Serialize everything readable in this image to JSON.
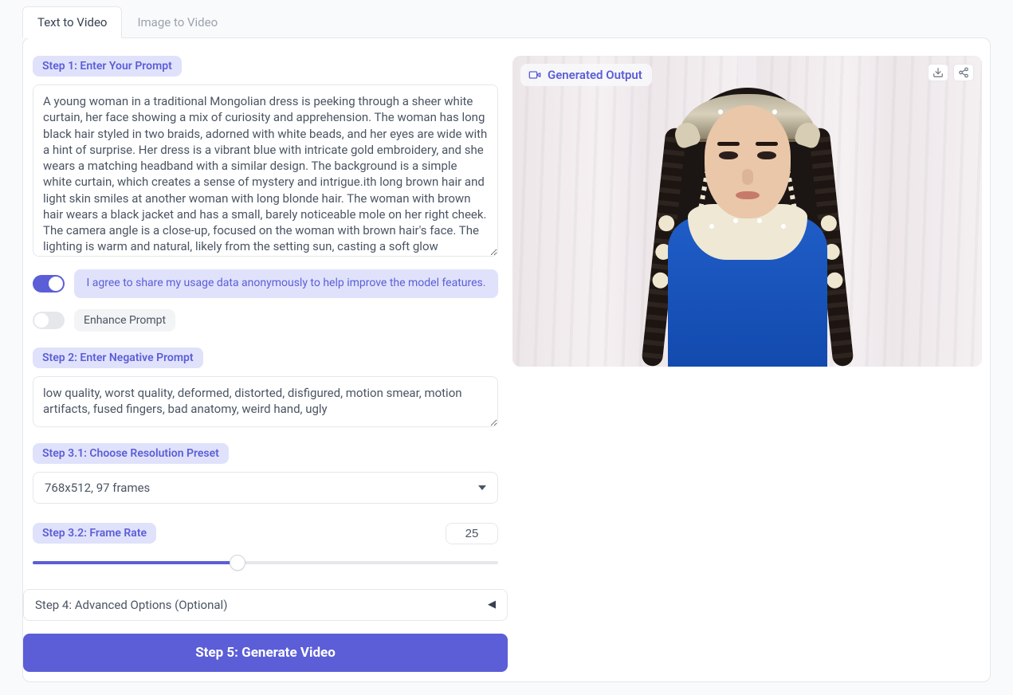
{
  "tabs": {
    "text_to_video": "Text to Video",
    "image_to_video": "Image to Video"
  },
  "step1": {
    "label": "Step 1: Enter Your Prompt",
    "value": "A young woman in a traditional Mongolian dress is peeking through a sheer white curtain, her face showing a mix of curiosity and apprehension. The woman has long black hair styled in two braids, adorned with white beads, and her eyes are wide with a hint of surprise. Her dress is a vibrant blue with intricate gold embroidery, and she wears a matching headband with a similar design. The background is a simple white curtain, which creates a sense of mystery and intrigue.ith long brown hair and light skin smiles at another woman with long blonde hair. The woman with brown hair wears a black jacket and has a small, barely noticeable mole on her right cheek. The camera angle is a close-up, focused on the woman with brown hair's face. The lighting is warm and natural, likely from the setting sun, casting a soft glow"
  },
  "share_toggle": {
    "on": true,
    "label": "I agree to share my usage data anonymously to help improve the model features."
  },
  "enhance_toggle": {
    "on": false,
    "label": "Enhance Prompt"
  },
  "step2": {
    "label": "Step 2: Enter Negative Prompt",
    "value": "low quality, worst quality, deformed, distorted, disfigured, motion smear, motion artifacts, fused fingers, bad anatomy, weird hand, ugly"
  },
  "step3_1": {
    "label": "Step 3.1: Choose Resolution Preset",
    "selected": "768x512, 97 frames"
  },
  "step3_2": {
    "label": "Step 3.2: Frame Rate",
    "value": "25",
    "fill_percent": 44
  },
  "step4": {
    "label": "Step 4: Advanced Options (Optional)"
  },
  "step5": {
    "label": "Step 5: Generate Video"
  },
  "output": {
    "label": "Generated Output"
  }
}
